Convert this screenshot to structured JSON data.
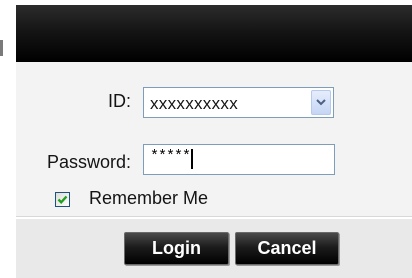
{
  "login_dialog": {
    "id_label": "ID:",
    "id_select_value": "xxxxxxxxxx",
    "password_label": "Password:",
    "password_value": "*****",
    "remember_label": "Remember Me",
    "remember_checked": true,
    "login_button": "Login",
    "cancel_button": "Cancel",
    "colors": {
      "titlebar": "#000000",
      "button": "#111111",
      "input_border": "#7e9db9",
      "checkmark": "#21a121"
    }
  }
}
